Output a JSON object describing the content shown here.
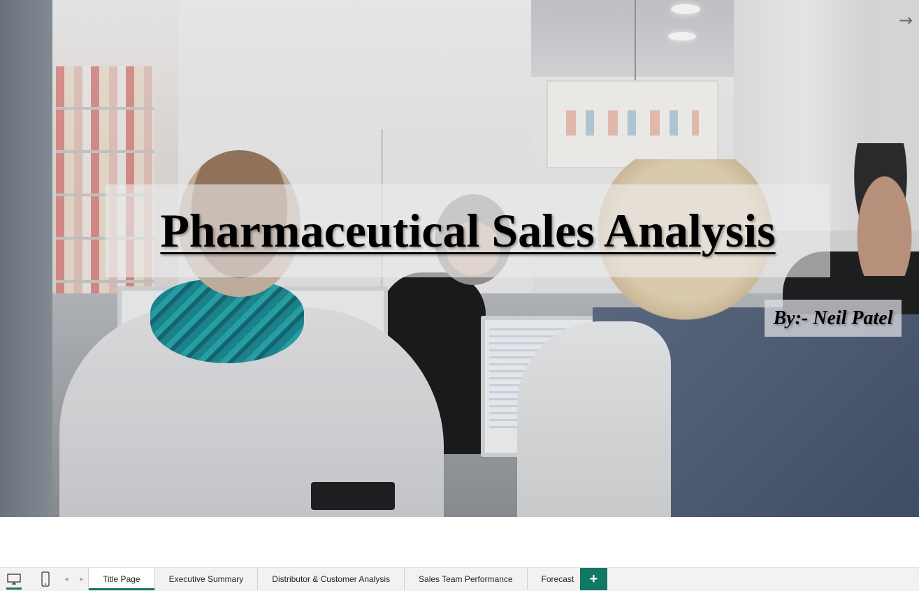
{
  "slide": {
    "title": "Pharmaceutical Sales Analysis",
    "author": "By:- Neil Patel",
    "background_description_icon": "pharmacy-photo",
    "next_icon": "→"
  },
  "tabbar": {
    "desktop_view_icon": "desktop-icon",
    "mobile_view_icon": "mobile-icon",
    "prev_label": "◂",
    "next_label": "▸",
    "tabs": [
      {
        "label": "Title Page",
        "active": true
      },
      {
        "label": "Executive Summary",
        "active": false
      },
      {
        "label": "Distributor & Customer Analysis",
        "active": false
      },
      {
        "label": "Sales Team Performance",
        "active": false
      },
      {
        "label": "Forecast",
        "active": false
      }
    ],
    "add_label": "+",
    "accent_color": "#117865"
  }
}
